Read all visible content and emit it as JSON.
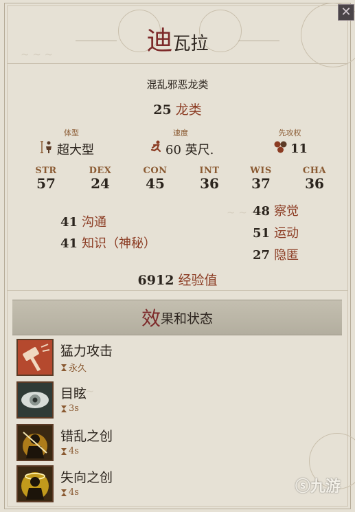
{
  "title": {
    "first": "迪",
    "rest": "瓦拉"
  },
  "alignment": "混乱邪恶龙类",
  "level": {
    "number": "25",
    "type": "龙类"
  },
  "physical": [
    {
      "label": "体型",
      "value": "超大型",
      "icon": "size-icon"
    },
    {
      "label": "速度",
      "value": "60 英尺.",
      "icon": "running-man-icon"
    },
    {
      "label": "先攻权",
      "value": "11",
      "icon": "initiative-dice-icon"
    }
  ],
  "abilities": [
    {
      "key": "STR",
      "value": "57"
    },
    {
      "key": "DEX",
      "value": "24"
    },
    {
      "key": "CON",
      "value": "45"
    },
    {
      "key": "INT",
      "value": "36"
    },
    {
      "key": "WIS",
      "value": "37"
    },
    {
      "key": "CHA",
      "value": "36"
    }
  ],
  "skills_left": [
    {
      "value": "41",
      "name": "沟通"
    },
    {
      "value": "41",
      "name": "知识（神秘）"
    }
  ],
  "skills_right": [
    {
      "value": "48",
      "name": "察觉"
    },
    {
      "value": "51",
      "name": "运动"
    },
    {
      "value": "27",
      "name": "隐匿"
    }
  ],
  "experience": {
    "value": "6912",
    "label": "经验值"
  },
  "effects_header": {
    "first": "效",
    "rest": "果和状态"
  },
  "effects": [
    {
      "name": "猛力攻击",
      "duration": "永久",
      "icon": "power-attack-hammer-icon"
    },
    {
      "name": "目眩",
      "duration": "3s",
      "icon": "dazzled-eye-icon"
    },
    {
      "name": "错乱之创",
      "duration": "4s",
      "icon": "confusion-wound-icon"
    },
    {
      "name": "失向之创",
      "duration": "4s",
      "icon": "disorientation-wound-icon"
    }
  ],
  "close_label": "✕",
  "watermark": "九游",
  "colors": {
    "accent_red": "#7d2a2a",
    "label_brown": "#8a5a32",
    "parchment": "#e6e1d5",
    "banner": "#bcb7a8"
  }
}
